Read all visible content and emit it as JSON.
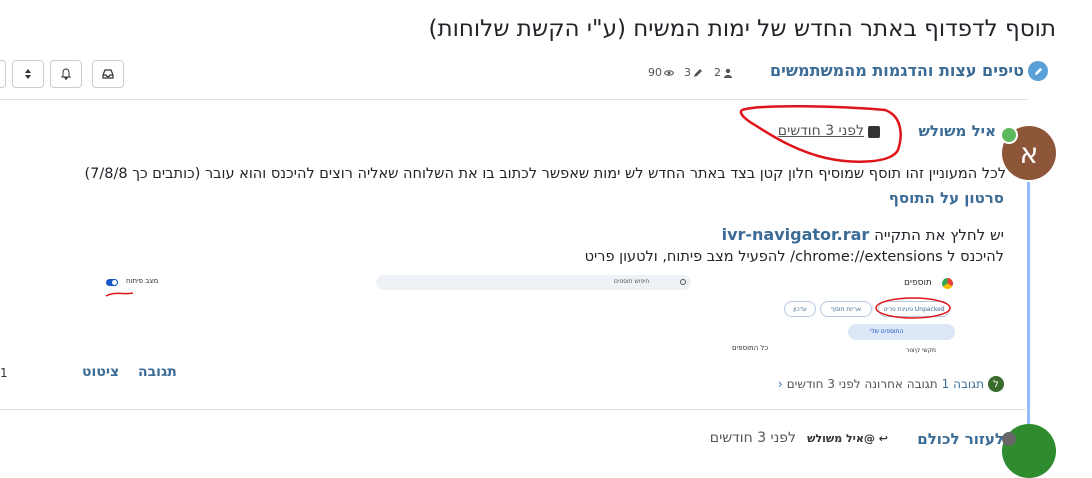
{
  "topic": {
    "title": "תוסף לדפדוף באתר החדש של ימות המשיח (ע\"י הקשת שלוחות)",
    "category": "טיפים עצות והדגמות מהמשתמשים",
    "stats": {
      "posters": "2",
      "posts": "3",
      "views": "90"
    }
  },
  "post": {
    "avatar_letter": "א",
    "author": "איל משולש",
    "time": "לפני 3 חודשים",
    "paragraph": "לכל המעוניין זהו תוסף שמוסיף חלון קטן בצד באתר החדש לש ימות שאפשר לכתוב בו את השלוחה שאליה רוצים להיכנס והוא עובר (כותבים כך 7/8/8)",
    "video_link": "סרטון על התוסף",
    "save_text": "יש לחלץ את התקייה",
    "file_link": "ivr-navigator.rar",
    "enter_text": "להיכנס ל chrome://extensions/ להפעיל מצב פיתוח, ולטעון פריט",
    "screenshot": {
      "header": "תוספים",
      "search_placeholder": "חיפוש תוספים",
      "dev_mode": "מצב פיתוח",
      "load_unpacked": "טעינת פריט Unpacked",
      "pack": "אריזת תוסף",
      "update": "עדכון",
      "my_extensions": "התוספים שלי",
      "shortcuts": "מקשי קיצור",
      "all_extensions": "כל התוספים"
    },
    "actions": {
      "reply": "תגובה",
      "quote": "ציטוט",
      "left_count": "1"
    },
    "replies_summary": {
      "count_label": "תגובה 1",
      "last": "תגובה אחרונה לפני 3 חודשים",
      "icon": "ל"
    }
  },
  "next_post": {
    "author": "לעזור לכולם",
    "reply_to": "@איל משולש",
    "time": "לפני 3 חודשים"
  },
  "colors": {
    "accent": "#3b6c96",
    "annotation": "#e0141b",
    "avatar": "#8d5638"
  }
}
